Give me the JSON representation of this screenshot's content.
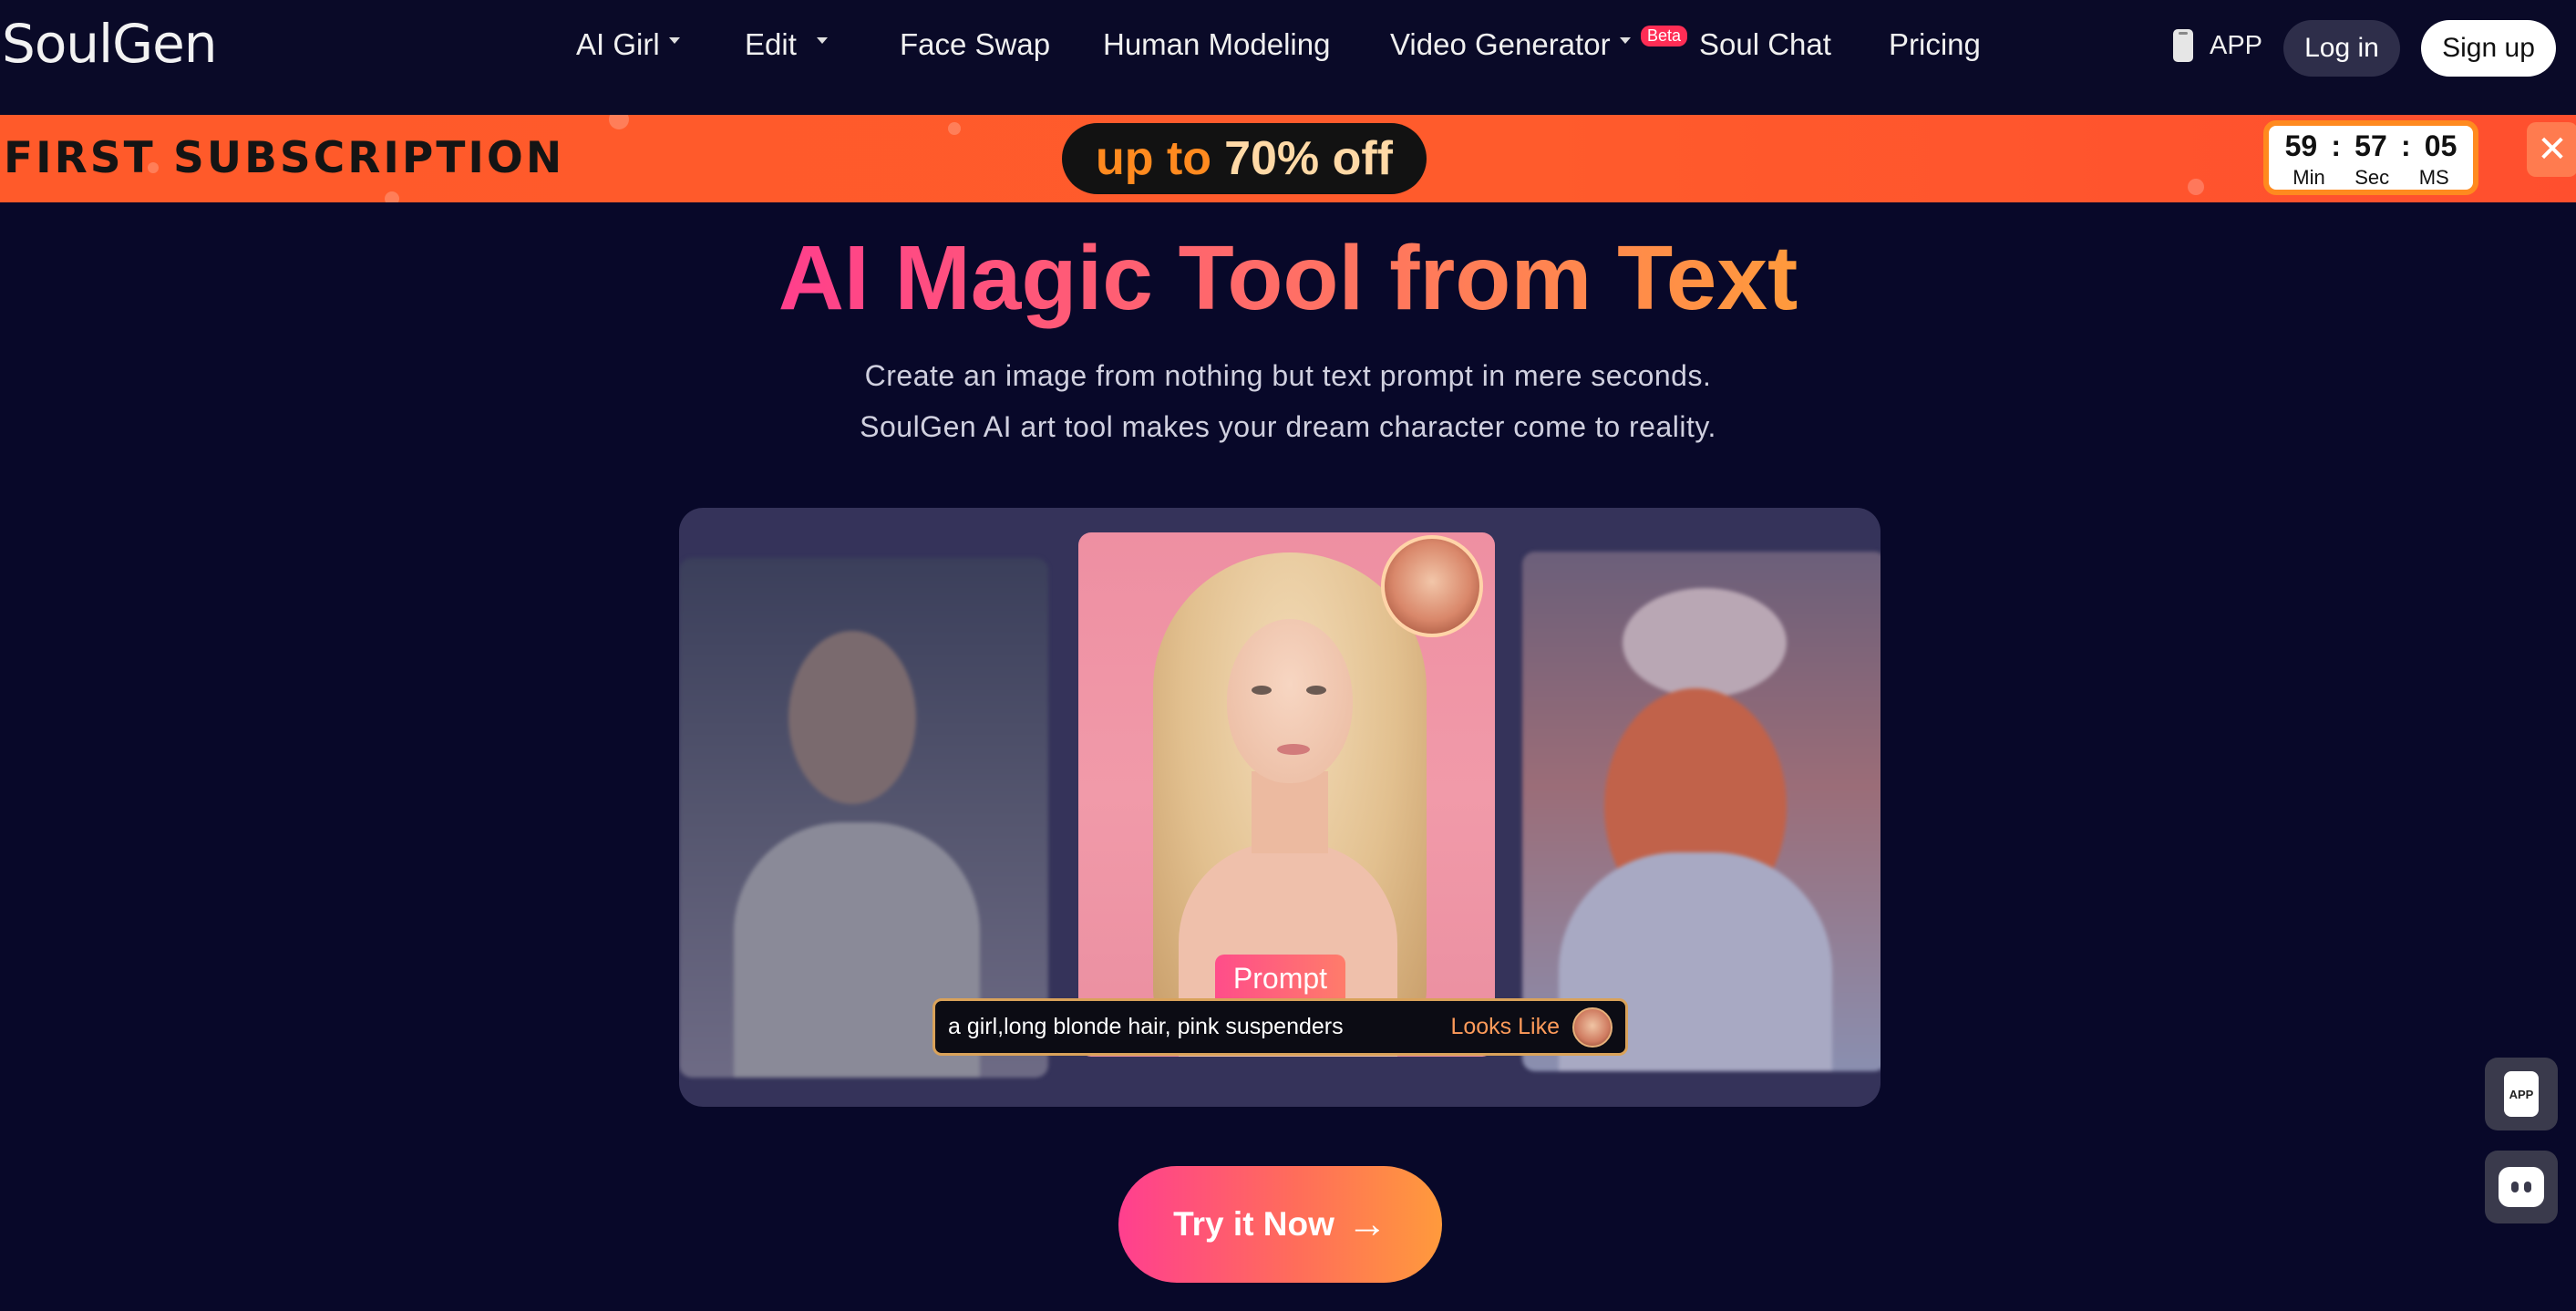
{
  "brand": {
    "logo_text": "SoulGen"
  },
  "nav": {
    "items": [
      {
        "label": "AI Girl",
        "dropdown": true
      },
      {
        "label": "Edit",
        "dropdown": true
      },
      {
        "label": "Face Swap",
        "dropdown": false
      },
      {
        "label": "Human Modeling",
        "dropdown": false
      },
      {
        "label": "Video Generator",
        "dropdown": true,
        "badge": "Beta"
      },
      {
        "label": "Soul Chat",
        "dropdown": false
      },
      {
        "label": "Pricing",
        "dropdown": false
      }
    ],
    "app_label": "APP",
    "login_label": "Log in",
    "signup_label": "Sign up"
  },
  "promo": {
    "headline": "FIRST SUBSCRIPTION",
    "offer_prefix": "up to",
    "offer_value": "70% off",
    "timer": {
      "min": "59",
      "sec": "57",
      "ms": "05",
      "sep": ":",
      "min_label": "Min",
      "sec_label": "Sec",
      "ms_label": "MS"
    },
    "close_icon": "close-icon",
    "background_color": "#ff5a2a",
    "accent_color": "#ff8a1f"
  },
  "hero": {
    "title": "AI Magic Tool from Text",
    "subtitle_line1": "Create an image from nothing but text prompt in mere seconds.",
    "subtitle_line2": "SoulGen AI art tool makes your dream character come to reality."
  },
  "showcase": {
    "prompt_tag": "Prompt",
    "prompt_text": "a girl,long blonde hair, pink suspenders",
    "looks_like_label": "Looks Like"
  },
  "cta": {
    "label": "Try it Now",
    "arrow": "→"
  },
  "floating": {
    "app_button_label": "APP",
    "chat_button_icon": "chat-icon"
  },
  "colors": {
    "background": "#080829",
    "title_gradient_start": "#ff3f8c",
    "title_gradient_end": "#ff9a3c"
  }
}
